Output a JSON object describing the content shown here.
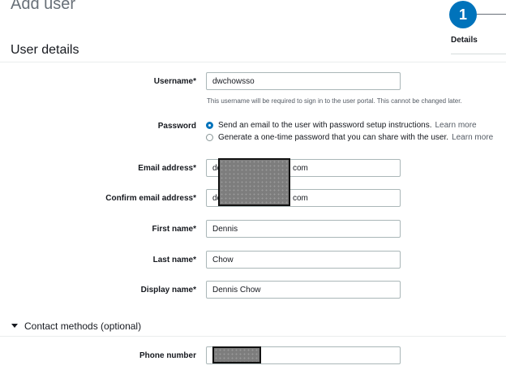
{
  "page": {
    "title": "Add user"
  },
  "stepper": {
    "number": "1",
    "label": "Details"
  },
  "user_details": {
    "title": "User details",
    "username": {
      "label": "Username*",
      "value": "dwchowsso",
      "hint": "This username will be required to sign in to the user portal. This cannot be changed later."
    },
    "password": {
      "label": "Password",
      "options": [
        {
          "text": "Send an email to the user with password setup instructions.",
          "link": "Learn more",
          "selected": true
        },
        {
          "text": "Generate a one-time password that you can share with the user.",
          "link": "Learn more",
          "selected": false
        }
      ]
    },
    "email": {
      "label": "Email address*",
      "value_prefix": "do",
      "value_suffix": "com"
    },
    "confirm_email": {
      "label": "Confirm email address*",
      "value_prefix": "do",
      "value_suffix": "com"
    },
    "first_name": {
      "label": "First name*",
      "value": "Dennis"
    },
    "last_name": {
      "label": "Last name*",
      "value": "Chow"
    },
    "display_name": {
      "label": "Display name*",
      "value": "Dennis Chow"
    }
  },
  "contact_methods": {
    "title": "Contact methods (optional)",
    "phone": {
      "label": "Phone number"
    }
  },
  "colors": {
    "accent": "#0073bb",
    "redaction": "#7d7d7d"
  }
}
